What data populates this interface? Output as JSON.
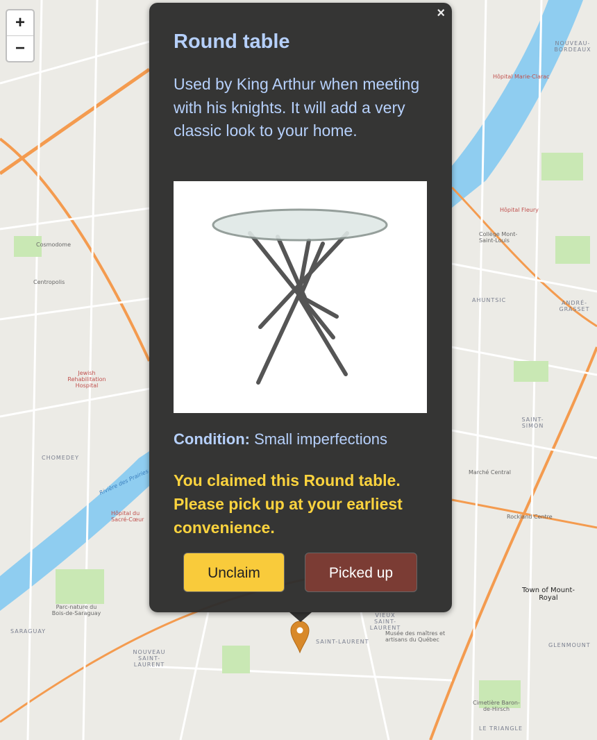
{
  "zoom_controls": {
    "zoom_in": "+",
    "zoom_out": "−"
  },
  "map_labels": {
    "chomedey": "CHOMEDEY",
    "ahuntsic": "AHUNTSIC",
    "mount_royal": "Town of Mount-Royal",
    "saint_laurent": "SAINT-LAURENT",
    "nouveau_saint_laurent": "NOUVEAU SAINT-LAURENT",
    "vieux_saint_laurent": "VIEUX SAINT-LAURENT",
    "saraguay": "SARAGUAY",
    "saint_simon": "SAINT-SIMON",
    "glenmount": "GLENMOUNT",
    "le_triangle": "LE TRIANGLE",
    "nouveau_bordeaux": "NOUVEAU-BORDEAUX",
    "andre_grasset": "ANDRÉ-GRASSET",
    "riviere": "Rivière des Prairies",
    "cosmodome": "Cosmodome",
    "centropolis": "Centropolis",
    "jewish_hospital": "Jewish Rehabilitation Hospital",
    "hopital_fleury": "Hôpital Fleury",
    "hopital_sacre_coeur": "Hôpital du Sacré-Cœur",
    "marche_central": "Marché Central",
    "rockland": "Rockland Centre",
    "parc_saraguay": "Parc-nature du Bois-de-Saraguay",
    "cimetiere": "Cimetière Baron-de-Hirsch",
    "musee": "Musée des maîtres et artisans du Québec",
    "hopital_marie_clarac": "Hôpital Marie-Clarac",
    "college": "Collège Mont-Saint-Louis"
  },
  "popup": {
    "close": "×",
    "title": "Round table",
    "description": "Used by King Arthur when meeting with his knights. It will add a very classic look to your home.",
    "condition_label": "Condition:",
    "condition_value": "Small imperfections",
    "claimed_message": "You claimed this Round table. Please pick up at your earliest convenience.",
    "unclaim_button": "Unclaim",
    "picked_up_button": "Picked up"
  },
  "colors": {
    "title": "#b6d0fb",
    "message": "#fbd33e",
    "unclaim": "#f9cb3b",
    "picked_up": "#7b3c34",
    "marker": "#d8892a"
  }
}
